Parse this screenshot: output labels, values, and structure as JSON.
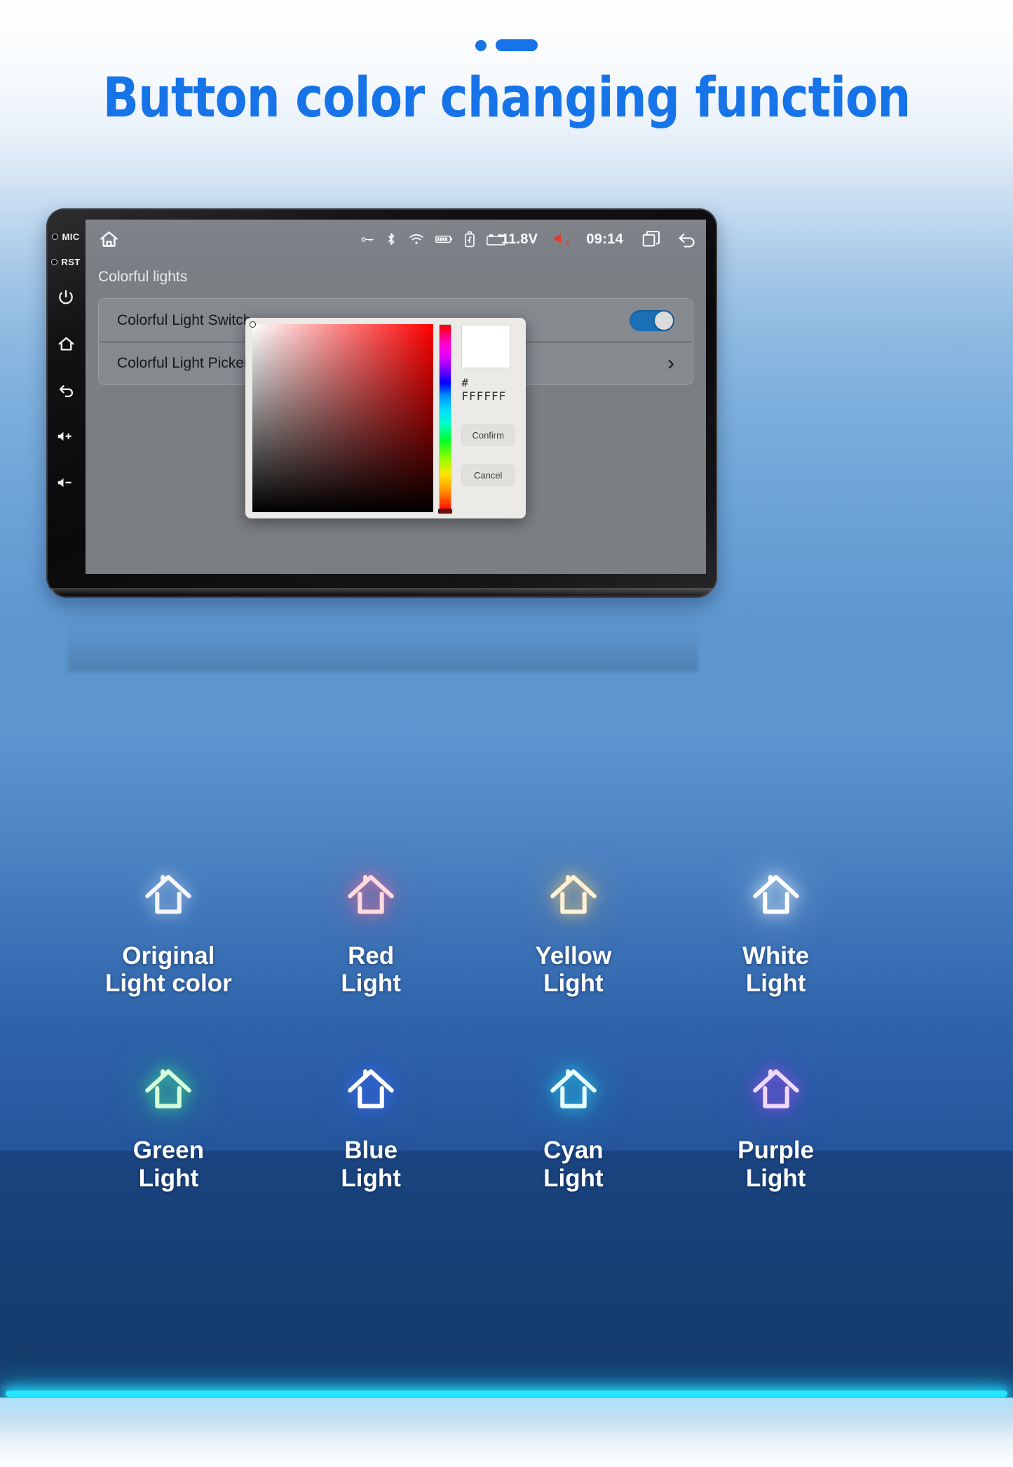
{
  "header": {
    "title": "Button color changing function",
    "accent_color": "#1673e8",
    "deco_dot": "dot",
    "deco_dash": "dash"
  },
  "head_unit": {
    "bezel": {
      "mic_label": "MIC",
      "rst_label": "RST",
      "buttons": [
        {
          "name": "power-icon",
          "label": "power"
        },
        {
          "name": "home-icon",
          "label": "home"
        },
        {
          "name": "back-icon",
          "label": "back"
        },
        {
          "name": "volume-up-icon",
          "label": "volume up"
        },
        {
          "name": "volume-down-icon",
          "label": "volume down"
        }
      ]
    },
    "statusbar": {
      "home_icon": "home-icon",
      "icons": [
        "key-icon",
        "bluetooth-icon",
        "wifi-icon",
        "battery-icon",
        "usb-icon",
        "car-battery-icon"
      ],
      "voltage": "11.8V",
      "mute_icon": "speaker-mute-icon",
      "time": "09:14",
      "recents_icon": "recents-icon",
      "back_icon": "back-arrow-icon"
    },
    "page_title": "Colorful lights",
    "rows": [
      {
        "label": "Colorful Light Switch",
        "control": "toggle",
        "toggle_on": true
      },
      {
        "label": "Colorful Light Picker",
        "control": "chevron",
        "chevron": "›"
      }
    ],
    "color_picker": {
      "hex_symbol": "#",
      "hex_value": "FFFFFF",
      "swatch_color": "#FFFFFF",
      "confirm_label": "Confirm",
      "cancel_label": "Cancel",
      "hue_base": "#ff0000"
    }
  },
  "light_grid": {
    "items": [
      {
        "label": "Original\nLight color",
        "icon": "house-icon",
        "color": "#f3f6fb",
        "glow": "rgba(220,235,255,0.55)"
      },
      {
        "label": "Red\nLight",
        "icon": "house-icon",
        "color": "#ffd9dd",
        "glow": "rgba(255,110,150,0.85)"
      },
      {
        "label": "Yellow\nLight",
        "icon": "house-icon",
        "color": "#fff1d2",
        "glow": "rgba(255,210,120,0.85)"
      },
      {
        "label": "White\nLight",
        "icon": "house-icon",
        "color": "#ffffff",
        "glow": "rgba(235,248,255,0.95)"
      },
      {
        "label": "Green\nLight",
        "icon": "house-icon",
        "color": "#d4ffd9",
        "glow": "rgba(70,255,150,0.85)"
      },
      {
        "label": "Blue\nLight",
        "icon": "house-icon",
        "color": "#ffffff",
        "glow": "rgba(60,110,255,0.95)"
      },
      {
        "label": "Cyan\nLight",
        "icon": "house-icon",
        "color": "#e6ffff",
        "glow": "rgba(40,230,255,0.9)"
      },
      {
        "label": "Purple\nLight",
        "icon": "house-icon",
        "color": "#f0d9ff",
        "glow": "rgba(170,80,255,0.9)"
      }
    ]
  }
}
